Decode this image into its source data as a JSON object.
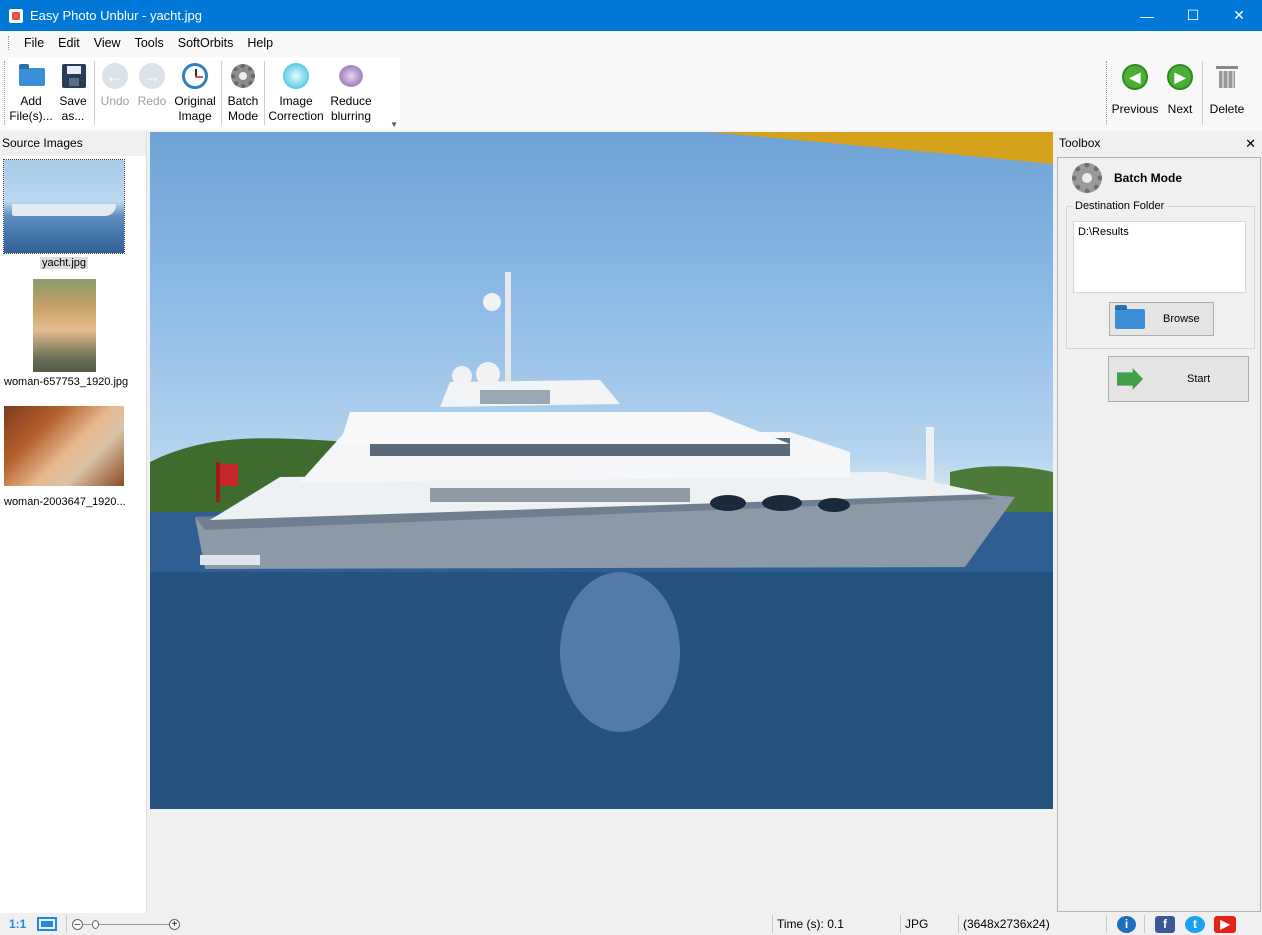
{
  "window": {
    "title": "Easy Photo Unblur - yacht.jpg"
  },
  "menu": {
    "items": [
      {
        "label": "File"
      },
      {
        "label": "Edit"
      },
      {
        "label": "View"
      },
      {
        "label": "Tools"
      },
      {
        "label": "SoftOrbits"
      },
      {
        "label": "Help"
      }
    ]
  },
  "toolbar": {
    "add_files": "Add\nFile(s)...",
    "add_files_l1": "Add",
    "add_files_l2": "File(s)...",
    "save_as_l1": "Save",
    "save_as_l2": "as...",
    "undo": "Undo",
    "redo": "Redo",
    "original_l1": "Original",
    "original_l2": "Image",
    "batch_l1": "Batch",
    "batch_l2": "Mode",
    "correction_l1": "Image",
    "correction_l2": "Correction",
    "reduce_l1": "Reduce",
    "reduce_l2": "blurring",
    "previous": "Previous",
    "next": "Next",
    "delete": "Delete"
  },
  "source_images": {
    "header": "Source Images",
    "items": [
      {
        "name": "yacht.jpg",
        "selected": true
      },
      {
        "name": "woman-657753_1920.jpg",
        "selected": false
      },
      {
        "name": "woman-2003647_1920...",
        "selected": false
      }
    ]
  },
  "toolbox": {
    "header": "Toolbox",
    "mode_label": "Batch Mode",
    "dest_legend": "Destination Folder",
    "dest_value": "D:\\Results",
    "browse_label": "Browse",
    "start_label": "Start"
  },
  "status": {
    "zoom_label": "1:1",
    "time": "Time (s): 0.1",
    "format": "JPG",
    "dimensions": "(3648x2736x24)"
  },
  "icons": {
    "info": "info-icon",
    "facebook": "facebook-icon",
    "twitter": "twitter-icon",
    "youtube": "youtube-icon"
  },
  "colors": {
    "titlebar": "#0078d7",
    "accent_green": "#4caf35"
  }
}
